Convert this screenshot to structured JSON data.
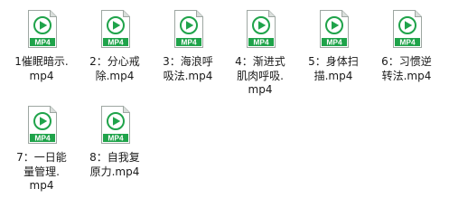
{
  "files": [
    {
      "name": "1催眠暗示.\nmp4",
      "badge": "MP4"
    },
    {
      "name": "2：分心戒\n除.mp4",
      "badge": "MP4"
    },
    {
      "name": "3：海浪呼\n吸法.mp4",
      "badge": "MP4"
    },
    {
      "name": "4：渐进式\n肌肉呼吸.\nmp4",
      "badge": "MP4"
    },
    {
      "name": "5：身体扫\n描.mp4",
      "badge": "MP4"
    },
    {
      "name": "6：习惯逆\n转法.mp4",
      "badge": "MP4"
    },
    {
      "name": "7：一日能\n量管理.\nmp4",
      "badge": "MP4"
    },
    {
      "name": "8：自我复\n原力.mp4",
      "badge": "MP4"
    }
  ],
  "colors": {
    "icon_green": "#1fa34a",
    "icon_border": "#9ea7a2",
    "icon_fold": "#d9dedb"
  }
}
